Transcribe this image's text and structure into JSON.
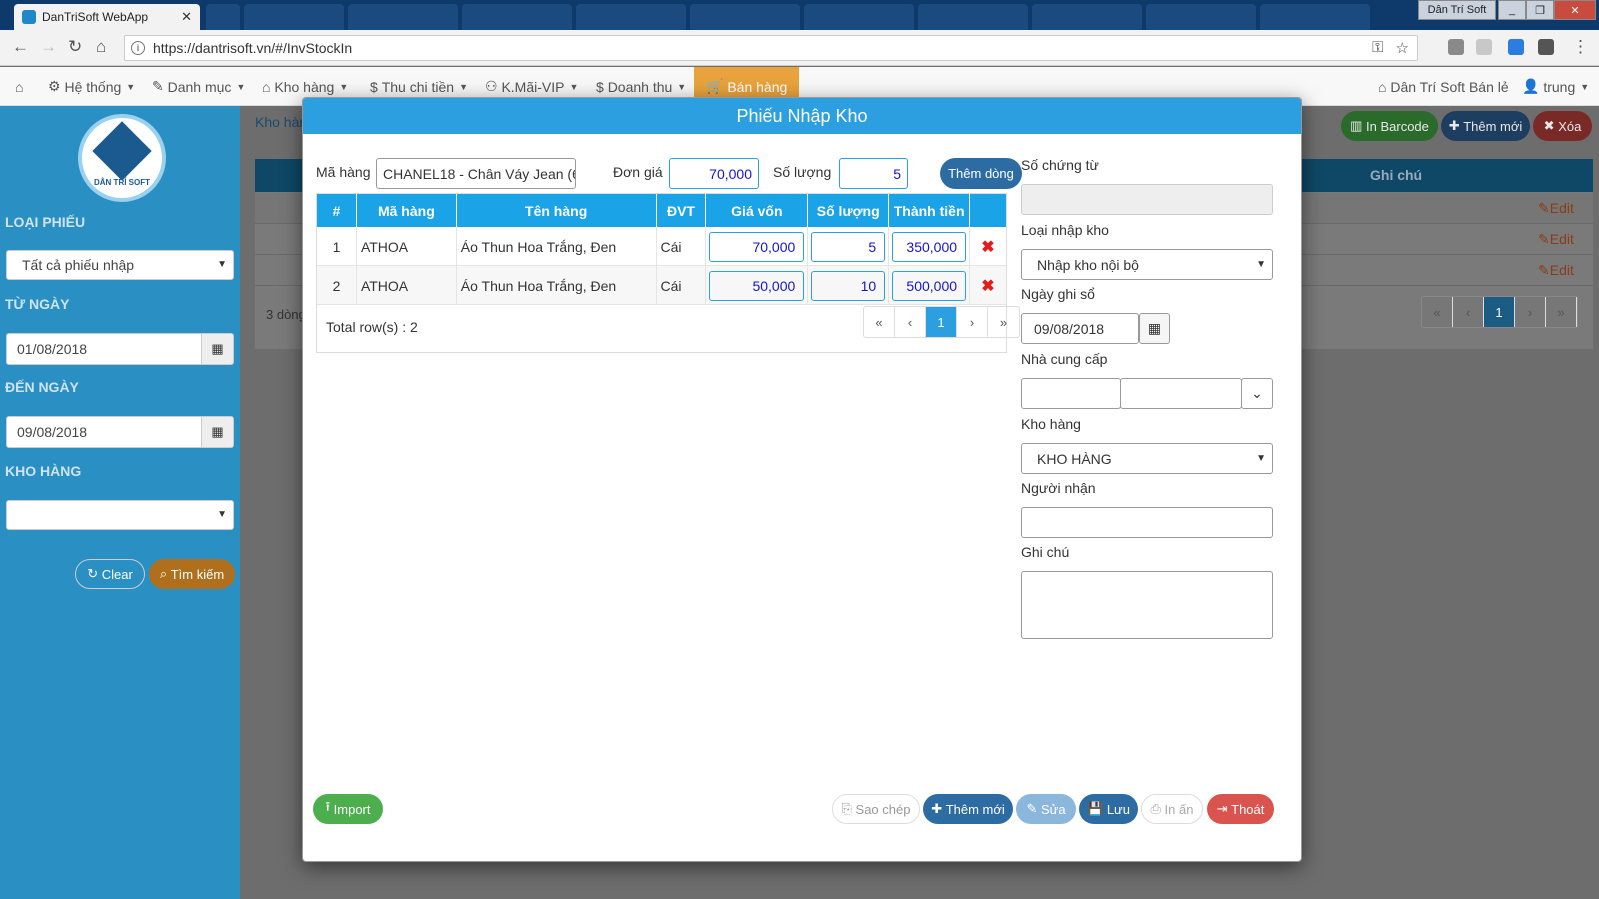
{
  "browser": {
    "tab_title": "DanTriSoft WebApp",
    "url": "https://dantrisoft.vn/#/InvStockIn",
    "window_user": "Dân Trí Soft"
  },
  "appnav": {
    "items": [
      {
        "label": "Hệ thống",
        "icon": "gear-icon"
      },
      {
        "label": "Danh mục",
        "icon": "wrench-icon"
      },
      {
        "label": "Kho hàng",
        "icon": "home-icon"
      },
      {
        "label": "Thu chi tiền",
        "icon": "dollar-icon"
      },
      {
        "label": "K.Mãi-VIP",
        "icon": "users-icon"
      },
      {
        "label": "Doanh thu",
        "icon": "dollar-icon"
      },
      {
        "label": "Bán hàng",
        "icon": "cart-icon"
      }
    ],
    "store": "Dân Trí Soft Bán lẻ",
    "user": "trung"
  },
  "sidebar": {
    "logo_text": "DÂN TRÍ SOFT",
    "loai_phieu_label": "LOẠI PHIẾU",
    "loai_phieu_value": "Tất cả phiếu nhập",
    "tu_ngay_label": "TỪ NGÀY",
    "tu_ngay_value": "01/08/2018",
    "den_ngay_label": "ĐẾN NGÀY",
    "den_ngay_value": "09/08/2018",
    "kho_hang_label": "KHO HÀNG",
    "kho_hang_value": "",
    "clear_label": "Clear",
    "search_label": "Tìm kiếm"
  },
  "background": {
    "breadcrumb": "Kho hàng",
    "in_barcode": "In Barcode",
    "them_moi": "Thêm mới",
    "xoa": "Xóa",
    "ghi_chu_header": "Ghi chú",
    "edit_label": "Edit",
    "row_count": "3 dòng",
    "page": "1"
  },
  "modal": {
    "title": "Phiếu Nhập Kho",
    "ma_hang_label": "Mã hàng",
    "ma_hang_value": "CHANEL18 - Chân Váy Jean (61(",
    "don_gia_label": "Đơn giá",
    "don_gia_value": "70,000",
    "so_luong_label": "Số lượng",
    "so_luong_value": "5",
    "them_dong": "Thêm dòng",
    "grid": {
      "headers": [
        "#",
        "Mã hàng",
        "Tên hàng",
        "ĐVT",
        "Giá vốn",
        "Số lượng",
        "Thành tiền",
        ""
      ],
      "rows": [
        {
          "no": "1",
          "ma": "ATHOA",
          "ten": "Áo Thun Hoa Trắng, Đen",
          "dvt": "Cái",
          "gia_von": "70,000",
          "so_luong": "5",
          "thanh_tien": "350,000"
        },
        {
          "no": "2",
          "ma": "ATHOA",
          "ten": "Áo Thun Hoa Trắng, Đen",
          "dvt": "Cái",
          "gia_von": "50,000",
          "so_luong": "10",
          "thanh_tien": "500,000"
        }
      ],
      "total_rows": "Total row(s) : 2",
      "pager": [
        "«",
        "‹",
        "1",
        "›",
        "»"
      ]
    },
    "right": {
      "so_chung_tu_label": "Số chứng từ",
      "so_chung_tu_value": "",
      "loai_nhap_kho_label": "Loại nhập kho",
      "loai_nhap_kho_value": "Nhập kho nội bộ",
      "ngay_ghi_so_label": "Ngày ghi sổ",
      "ngay_ghi_so_value": "09/08/2018",
      "nha_cung_cap_label": "Nhà cung cấp",
      "kho_hang_label": "Kho hàng",
      "kho_hang_value": "KHO HÀNG",
      "nguoi_nhan_label": "Người nhận",
      "nguoi_nhan_value": "",
      "ghi_chu_label": "Ghi chú",
      "ghi_chu_value": ""
    },
    "footer": {
      "import": "Import",
      "sao_chep": "Sao chép",
      "them_moi": "Thêm mới",
      "sua": "Sửa",
      "luu": "Lưu",
      "in_an": "In ấn",
      "thoat": "Thoát"
    }
  },
  "colors": {
    "primary": "#2b9fe0",
    "sidebar": "#2a8fc3",
    "nav_active": "#e8a33c",
    "success": "#4cae4c",
    "danger": "#d9534f",
    "dark_blue": "#2d6ca2"
  }
}
